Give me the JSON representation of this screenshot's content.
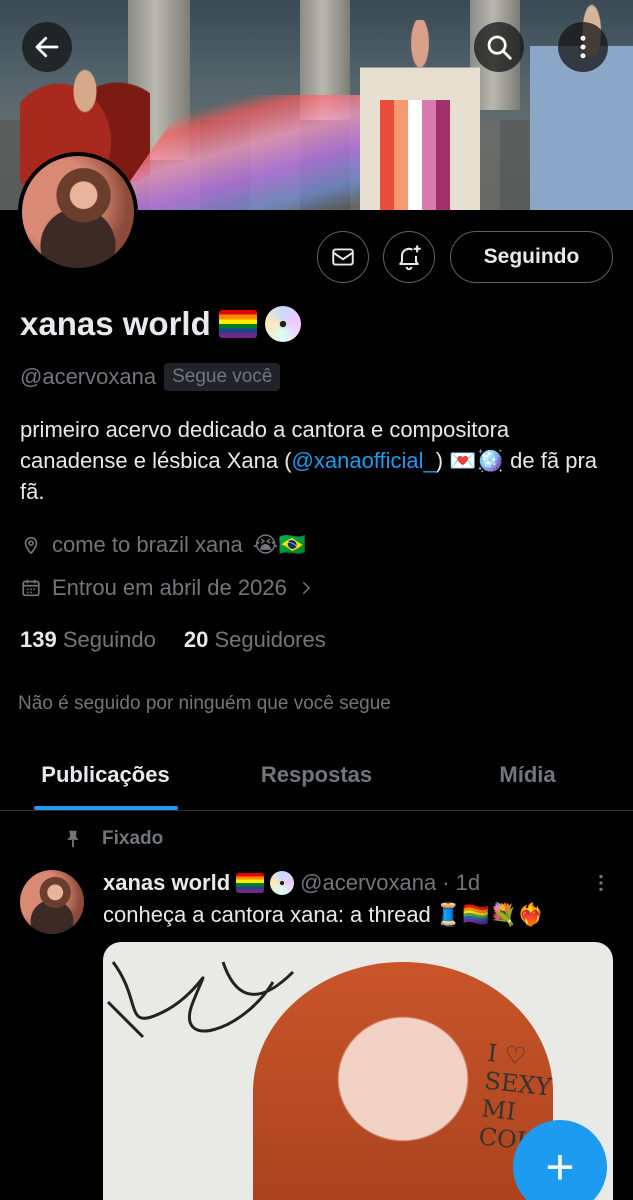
{
  "header": {
    "back_icon": "arrow-left-icon",
    "search_icon": "search-icon",
    "more_icon": "more-vertical-icon"
  },
  "profile": {
    "name": "xanas world",
    "handle": "@acervoxana",
    "follows_you": "Segue você",
    "bio_prefix": "primeiro acervo dedicado a cantora e compositora canadense e lésbica Xana (",
    "bio_mention": "@xanaofficial_",
    "bio_mid": ") ",
    "bio_suffix": " de fã pra fã.",
    "location": "come to brazil xana",
    "location_emoji": "😭🇧🇷",
    "joined": "Entrou em abril de 2026",
    "following_count": "139",
    "following_label": "Seguindo",
    "followers_count": "20",
    "followers_label": "Seguidores",
    "not_followed": "Não é seguido por ninguém que você segue",
    "follow_button": "Seguindo"
  },
  "tabs": [
    {
      "label": "Publicações",
      "active": true
    },
    {
      "label": "Respostas",
      "active": false
    },
    {
      "label": "Mídia",
      "active": false
    }
  ],
  "pinned_post": {
    "pinned_label": "Fixado",
    "author_name": "xanas world",
    "author_handle": "@acervoxana",
    "time": "· 1d",
    "text": "conheça a cantora xana: a thread",
    "text_emoji": "🧵🏳️‍🌈💐❤️‍🔥",
    "media_sign": "I ♡\nSEXY\nMI\nCOU"
  },
  "fab": {
    "label": "+"
  },
  "colors": {
    "accent": "#1d9bf0",
    "muted": "#71767b",
    "text": "#e7e9ea",
    "background": "#000000"
  }
}
